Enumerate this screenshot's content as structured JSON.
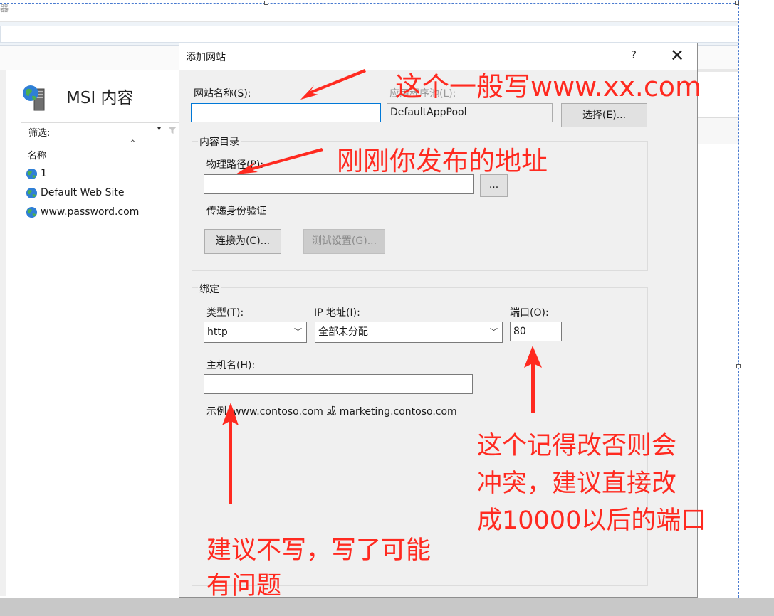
{
  "background": {
    "topstrip_text": "器",
    "page_title": "MSI 内容",
    "filter_label": "筛选:",
    "filter_dropdown_caret": "▾",
    "column_header": "名称",
    "sites": [
      "1",
      "Default Web Site",
      "www.password.com"
    ]
  },
  "dialog": {
    "title": "添加网站",
    "help": "?",
    "close": "✕",
    "site_name_label": "网站名称(S):",
    "site_name_value": "",
    "app_pool_label": "应用程序池(L):",
    "app_pool_value": "DefaultAppPool",
    "select_button": "选择(E)...",
    "content_dir_title": "内容目录",
    "physical_path_label": "物理路径(P):",
    "physical_path_value": "",
    "browse_button": "...",
    "passthrough_label": "传递身份验证",
    "connect_as_button": "连接为(C)...",
    "test_settings_button": "测试设置(G)...",
    "binding_title": "绑定",
    "type_label": "类型(T):",
    "type_value": "http",
    "ip_label": "IP 地址(I):",
    "ip_value": "全部未分配",
    "port_label": "端口(O):",
    "port_value": "80",
    "hostname_label": "主机名(H):",
    "hostname_value": "",
    "example_text": "示例: www.contoso.com 或 marketing.contoso.com"
  },
  "annotations": {
    "color": "#ff2a20",
    "site_name_note": "这个一般写www.xx.com",
    "path_note": "刚刚你发布的地址",
    "port_note_line1": "这个记得改否则会",
    "port_note_line2": "冲突，建议直接改",
    "port_note_line3": "成10000以后的端口",
    "hostname_note_line1": "建议不写，写了可能",
    "hostname_note_line2": "有问题"
  }
}
